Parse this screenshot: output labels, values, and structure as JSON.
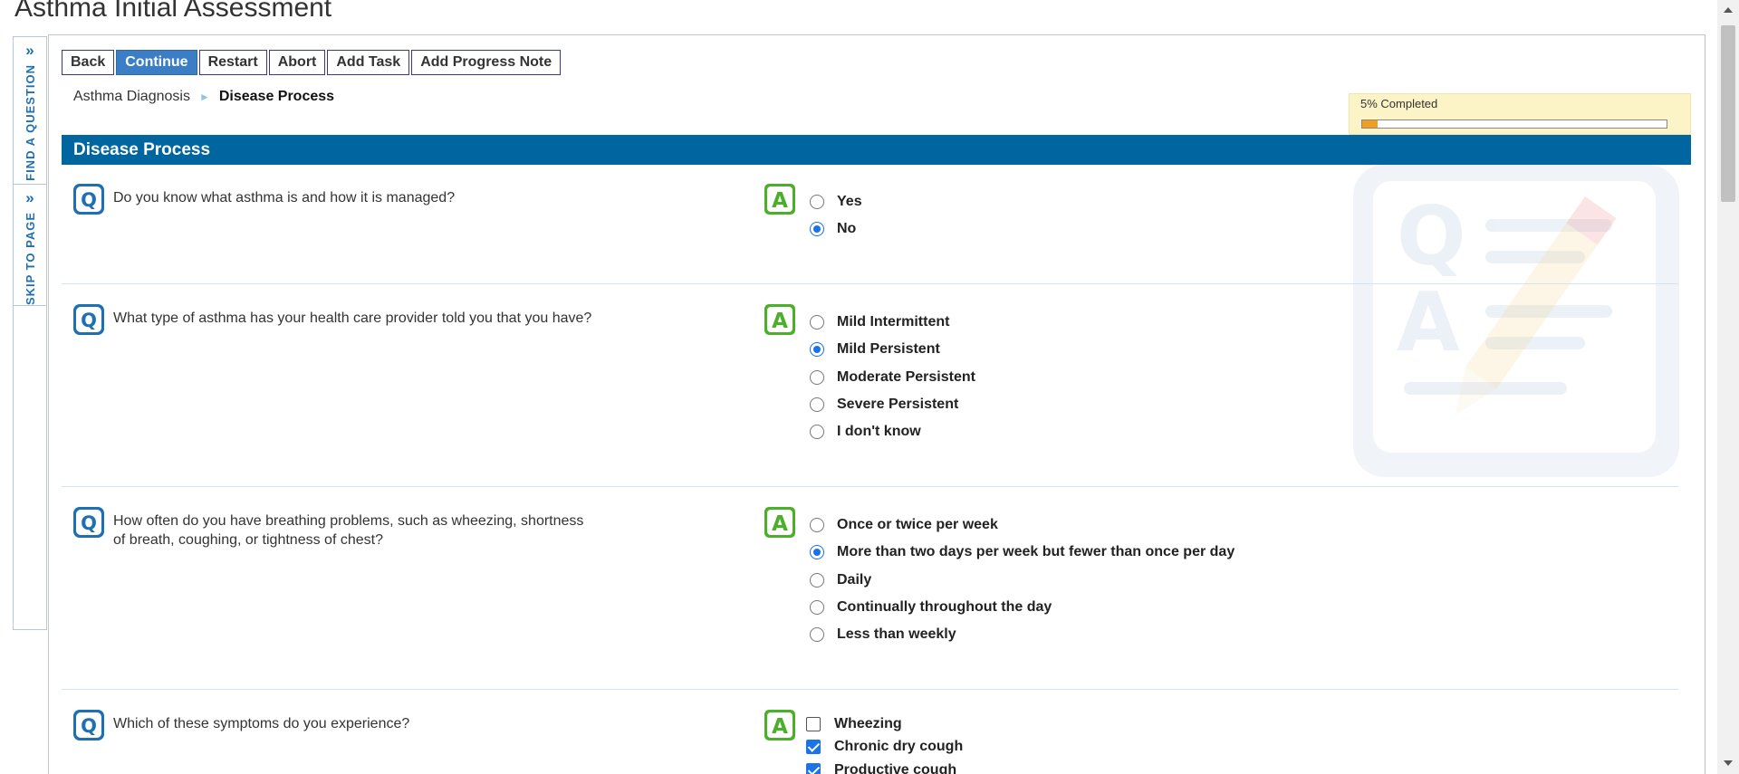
{
  "page": {
    "title": "Asthma Initial Assessment"
  },
  "side_tabs": {
    "find_question": "FIND A QUESTION",
    "skip_to_page": "SKIP TO PAGE"
  },
  "toolbar": {
    "back": "Back",
    "continue": "Continue",
    "restart": "Restart",
    "abort": "Abort",
    "add_task": "Add Task",
    "add_progress_note": "Add Progress Note"
  },
  "breadcrumb": {
    "parent": "Asthma Diagnosis",
    "current": "Disease Process"
  },
  "progress": {
    "label": "5% Completed",
    "percent": 5
  },
  "section": {
    "title": "Disease Process"
  },
  "questions": [
    {
      "text": "Do you know what asthma is and how it is managed?",
      "type": "radio",
      "options": [
        {
          "label": "Yes",
          "selected": false
        },
        {
          "label": "No",
          "selected": true
        }
      ]
    },
    {
      "text": "What type of asthma has your health care provider told you that you have?",
      "type": "radio",
      "options": [
        {
          "label": "Mild Intermittent",
          "selected": false
        },
        {
          "label": "Mild Persistent",
          "selected": true
        },
        {
          "label": "Moderate Persistent",
          "selected": false
        },
        {
          "label": "Severe Persistent",
          "selected": false
        },
        {
          "label": "I don't know",
          "selected": false
        }
      ]
    },
    {
      "text_line1": "How often do you have breathing problems, such as wheezing, shortness",
      "text_line2": "of breath, coughing, or tightness of chest?",
      "type": "radio",
      "options": [
        {
          "label": "Once or twice per week",
          "selected": false
        },
        {
          "label": "More than two days per week but fewer than once per day",
          "selected": true
        },
        {
          "label": "Daily",
          "selected": false
        },
        {
          "label": "Continually throughout the day",
          "selected": false
        },
        {
          "label": "Less than weekly",
          "selected": false
        }
      ]
    },
    {
      "text": "Which of these symptoms do you experience?",
      "type": "checkbox",
      "options": [
        {
          "label": "Wheezing",
          "selected": false
        },
        {
          "label": "Chronic dry cough",
          "selected": true
        },
        {
          "label": "Productive cough",
          "selected": true
        }
      ]
    }
  ],
  "icons": {
    "question": "Q",
    "answer": "A",
    "question_icon_color": "#1f6fb3",
    "answer_icon_color": "#4caf2a"
  }
}
